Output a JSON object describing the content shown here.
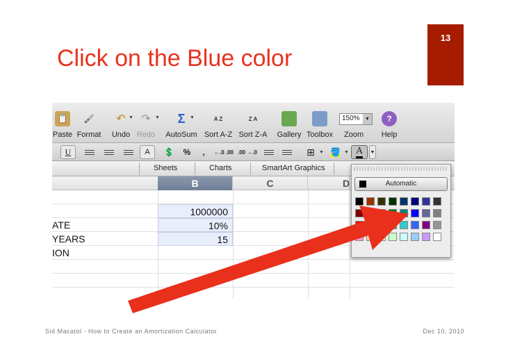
{
  "slide": {
    "page_number": "13",
    "title": "Click on the Blue color",
    "footer_left": "Sid Macatol - How to Create an Amortization Calculator",
    "footer_right": "Dec 10, 2010",
    "accent_color": "#a61c00",
    "title_color": "#e8321e",
    "arrow_color": "#e8301c"
  },
  "toolbar": {
    "paste": "Paste",
    "format": "Format",
    "undo": "Undo",
    "redo": "Redo",
    "autosum": "AutoSum",
    "sort_az": "Sort A-Z",
    "sort_za": "Sort Z-A",
    "gallery": "Gallery",
    "toolbox": "Toolbox",
    "zoom": "Zoom",
    "zoom_value": "150%",
    "help": "Help",
    "sort_az_icon_text": "A Z",
    "sort_za_icon_text": "Z A",
    "sigma": "Σ"
  },
  "format_bar": {
    "underline": "U",
    "font_size_icon": "A",
    "percent": "%",
    "comma": ",",
    "dec_increase": "←.0 .00",
    "dec_decrease": ".00 →.0",
    "font_color_letter": "A"
  },
  "ribbon_tabs": [
    "Sheets",
    "Charts",
    "SmartArt Graphics"
  ],
  "columns": [
    "B",
    "C",
    "D"
  ],
  "rows": [
    {
      "label": "",
      "value": ""
    },
    {
      "label": "",
      "value": "1000000"
    },
    {
      "label": "ATE",
      "value": "10%"
    },
    {
      "label": "YEARS",
      "value": "15"
    },
    {
      "label": "ION",
      "value": ""
    },
    {
      "label": "",
      "value": ""
    },
    {
      "label": "",
      "value": ""
    },
    {
      "label": "",
      "value": ""
    }
  ],
  "palette": {
    "automatic_label": "Automatic",
    "selected_swatch": "blue",
    "colors": [
      "#000000",
      "#993300",
      "#333300",
      "#003300",
      "#003366",
      "#000080",
      "#333399",
      "#333333",
      "#800000",
      "#ff6600",
      "#808000",
      "#008000",
      "#008080",
      "#0000ff",
      "#666699",
      "#808080",
      "#ff0000",
      "#ff9900",
      "#99cc00",
      "#339966",
      "#33cccc",
      "#3366ff",
      "#800080",
      "#969696",
      "#ff99cc",
      "#ffcc99",
      "#ffff99",
      "#ccffcc",
      "#ccffff",
      "#99ccff",
      "#cc99ff",
      "#ffffff"
    ]
  }
}
